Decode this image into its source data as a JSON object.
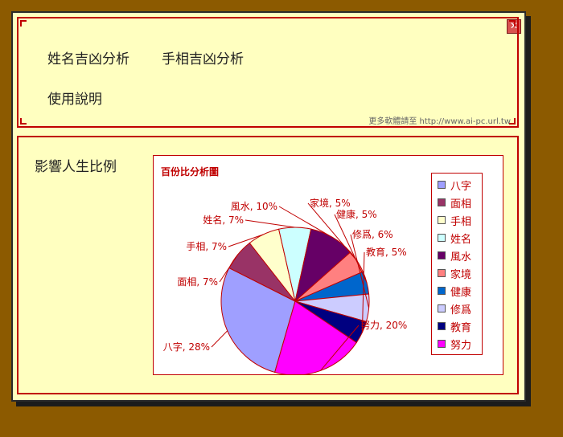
{
  "nav": {
    "name_analysis": "姓名吉凶分析",
    "palm_analysis": "手相吉凶分析",
    "instructions": "使用說明",
    "footer": "更多軟體請至 http://www.ai-pc.url.tw"
  },
  "section_title": "影響人生比例",
  "chart_data": {
    "type": "pie",
    "title": "百份比分析圖",
    "slices": [
      {
        "label": "八字",
        "value": 28,
        "display": "八字, 28%",
        "color": "#9f9fff"
      },
      {
        "label": "面相",
        "value": 7,
        "display": "面相, 7%",
        "color": "#993366"
      },
      {
        "label": "手相",
        "value": 7,
        "display": "手相, 7%",
        "color": "#ffffcc"
      },
      {
        "label": "姓名",
        "value": 7,
        "display": "姓名, 7%",
        "color": "#ccffff"
      },
      {
        "label": "風水",
        "value": 10,
        "display": "風水, 10%",
        "color": "#660066"
      },
      {
        "label": "家境",
        "value": 5,
        "display": "家境, 5%",
        "color": "#ff8080"
      },
      {
        "label": "健康",
        "value": 5,
        "display": "健康, 5%",
        "color": "#0066cc"
      },
      {
        "label": "修爲",
        "value": 6,
        "display": "修爲, 6%",
        "color": "#ccccff"
      },
      {
        "label": "教育",
        "value": 5,
        "display": "教育, 5%",
        "color": "#000080"
      },
      {
        "label": "努力",
        "value": 20,
        "display": "努力, 20%",
        "color": "#ff00ff"
      }
    ],
    "legend": [
      "八字",
      "面相",
      "手相",
      "姓名",
      "風水",
      "家境",
      "健康",
      "修爲",
      "教育",
      "努力"
    ],
    "legend_position": "right"
  }
}
